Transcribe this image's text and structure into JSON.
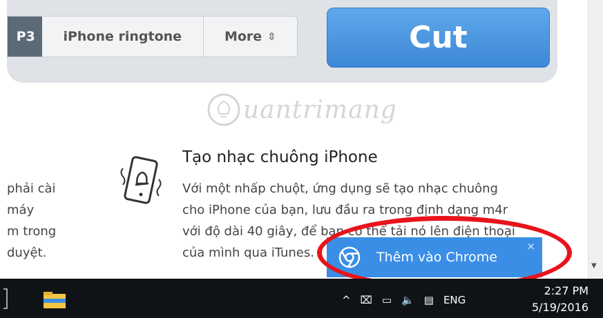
{
  "toolbar": {
    "formats": [
      "P3",
      "iPhone ringtone",
      "More"
    ],
    "more_icon": "up-down-arrows-icon",
    "cut_label": "Cut"
  },
  "watermark": {
    "text": "uantrimang"
  },
  "feature": {
    "title": "Tạo nhạc chuông iPhone",
    "lines": [
      "Với một nhấp chuột, ứng dụng sẽ tạo nhạc chuông",
      "cho iPhone của bạn, lưu đầu ra trong định dạng m4r",
      "với độ dài 40 giây, để bạn có thể tải nó lên điện thoại",
      "của mình qua iTunes."
    ],
    "icon": "vibrating-phone-bell-icon"
  },
  "left_column": {
    "lines": [
      "phải cài",
      "máy",
      "m trong",
      "duyệt."
    ]
  },
  "chrome_toast": {
    "label": "Thêm vào Chrome",
    "close": "×",
    "color": "#3a8ee6"
  },
  "taskbar": {
    "tray_items": [
      "^",
      "⌧",
      "▭",
      "🔈",
      "▤",
      "ENG"
    ],
    "time": "2:27 PM",
    "date": "5/19/2016"
  },
  "colors": {
    "accent": "#4a98e6",
    "highlight": "#e8141b"
  }
}
